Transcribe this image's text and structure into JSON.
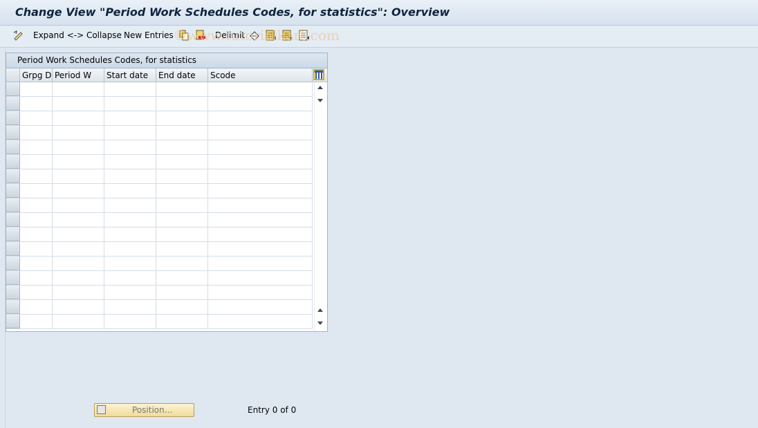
{
  "window": {
    "title": "Change View \"Period Work Schedules Codes, for statistics\": Overview"
  },
  "toolbar": {
    "expand_collapse": "Expand <-> Collapse",
    "new_entries": "New Entries",
    "delimit": "Delimit",
    "watermark": "©www.tutorialkart.com"
  },
  "table": {
    "title": "Period Work Schedules Codes, for statistics",
    "columns": [
      "Grpg D",
      "Period W",
      "Start date",
      "End date",
      "Scode"
    ],
    "rows": [
      [
        "",
        "",
        "",
        "",
        ""
      ],
      [
        "",
        "",
        "",
        "",
        ""
      ],
      [
        "",
        "",
        "",
        "",
        ""
      ],
      [
        "",
        "",
        "",
        "",
        ""
      ],
      [
        "",
        "",
        "",
        "",
        ""
      ],
      [
        "",
        "",
        "",
        "",
        ""
      ],
      [
        "",
        "",
        "",
        "",
        ""
      ],
      [
        "",
        "",
        "",
        "",
        ""
      ],
      [
        "",
        "",
        "",
        "",
        ""
      ],
      [
        "",
        "",
        "",
        "",
        ""
      ],
      [
        "",
        "",
        "",
        "",
        ""
      ],
      [
        "",
        "",
        "",
        "",
        ""
      ],
      [
        "",
        "",
        "",
        "",
        ""
      ],
      [
        "",
        "",
        "",
        "",
        ""
      ],
      [
        "",
        "",
        "",
        "",
        ""
      ],
      [
        "",
        "",
        "",
        "",
        ""
      ],
      [
        "",
        "",
        "",
        "",
        ""
      ]
    ]
  },
  "footer": {
    "position_label": "Position...",
    "entry_text": "Entry 0 of 0"
  },
  "colors": {
    "accent": "#d2a81e",
    "background": "#dfe8f1"
  }
}
